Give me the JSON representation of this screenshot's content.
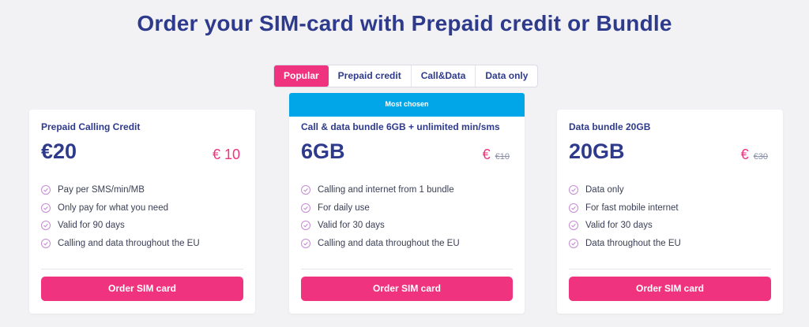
{
  "page": {
    "title": "Order your SIM-card with Prepaid credit or Bundle"
  },
  "tabs": [
    {
      "label": "Popular",
      "active": true
    },
    {
      "label": "Prepaid credit",
      "active": false
    },
    {
      "label": "Call&Data",
      "active": false
    },
    {
      "label": "Data only",
      "active": false
    }
  ],
  "cards": [
    {
      "subtitle": "Prepaid Calling Credit",
      "big_value": "€20",
      "price_symbol": "€",
      "price_value": "10",
      "price_old": "",
      "features": [
        "Pay per SMS/min/MB",
        "Only pay for what you need",
        "Valid for 90 days",
        "Calling and data throughout the EU"
      ],
      "button_label": "Order SIM card"
    },
    {
      "badge": "Most chosen",
      "subtitle": "Call & data bundle 6GB + unlimited min/sms",
      "big_value": "6GB",
      "price_symbol": "€",
      "price_value": "",
      "price_old": "€10",
      "features": [
        "Calling and internet from 1 bundle",
        "For daily use",
        "Valid for 30 days",
        "Calling and data throughout the EU"
      ],
      "button_label": "Order SIM card"
    },
    {
      "subtitle": "Data bundle 20GB",
      "big_value": "20GB",
      "price_symbol": "€",
      "price_value": "",
      "price_old": "€30",
      "features": [
        "Data only",
        "For fast mobile internet",
        "Valid for 30 days",
        "Data throughout the EU"
      ],
      "button_label": "Order SIM card"
    }
  ],
  "colors": {
    "accent": "#f0337f",
    "navy": "#2e3a8c",
    "badge": "#00a6e8",
    "background": "#f2f2f4"
  },
  "icons": {
    "feature": "check-circle-icon"
  }
}
